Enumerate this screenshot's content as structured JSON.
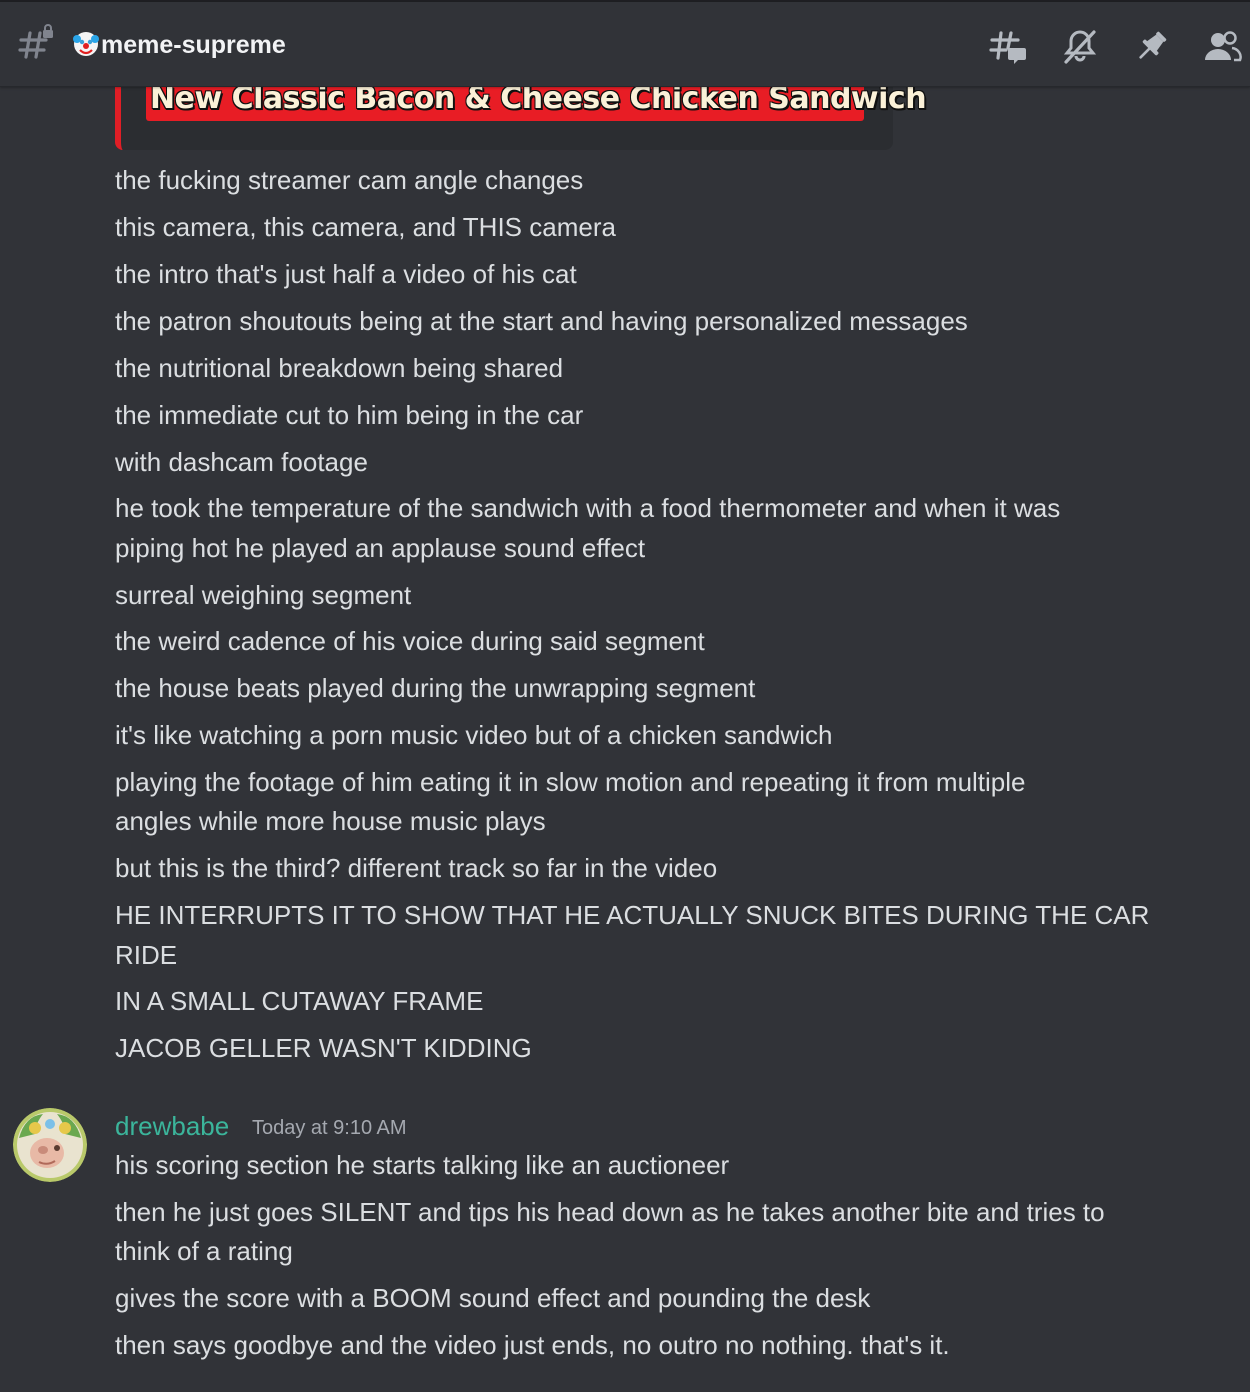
{
  "header": {
    "channel_name": "meme-supreme",
    "icons": [
      "hashtag-lock-icon",
      "clown-emoji",
      "threads-icon",
      "mute-bell-icon",
      "pin-icon",
      "member-list-icon"
    ]
  },
  "embed": {
    "title": "New Classic Bacon & Cheese Chicken Sandwich",
    "accent_color": "#e01e26"
  },
  "messages_continued": [
    "the fucking streamer cam angle changes",
    "this camera, this camera, and THIS camera",
    "the intro that's just half a video of his cat",
    "the patron shoutouts being at the start and having personalized messages",
    "the nutritional breakdown being shared",
    "the immediate cut to him being in the car",
    "with dashcam footage",
    "he took the temperature of the sandwich with a food thermometer and when it was",
    "piping hot he played an applause sound effect",
    "surreal weighing segment",
    "the weird cadence of his voice during said segment",
    "the house beats played during the unwrapping segment",
    "it's like watching a porn music video but of a chicken sandwich",
    "playing the footage of him eating it in slow motion and repeating it from multiple",
    "angles while more house music plays",
    "but this is the third? different track so far in the video",
    "HE INTERRUPTS IT TO SHOW THAT HE ACTUALLY SNUCK BITES DURING THE CAR",
    "RIDE",
    "IN A SMALL CUTAWAY FRAME",
    "JACOB GELLER WASN'T KIDDING"
  ],
  "message_group": {
    "username": "drewbabe",
    "username_color": "#3bb59b",
    "timestamp": "Today at 9:10 AM",
    "lines": [
      "his scoring section he starts talking like an auctioneer",
      "then he just goes SILENT and tips his head down as he takes another bite and tries to",
      "think of a rating",
      "gives the score with a BOOM sound effect and pounding the desk",
      "then says goodbye and the video just ends, no outro no nothing. that's it."
    ]
  }
}
